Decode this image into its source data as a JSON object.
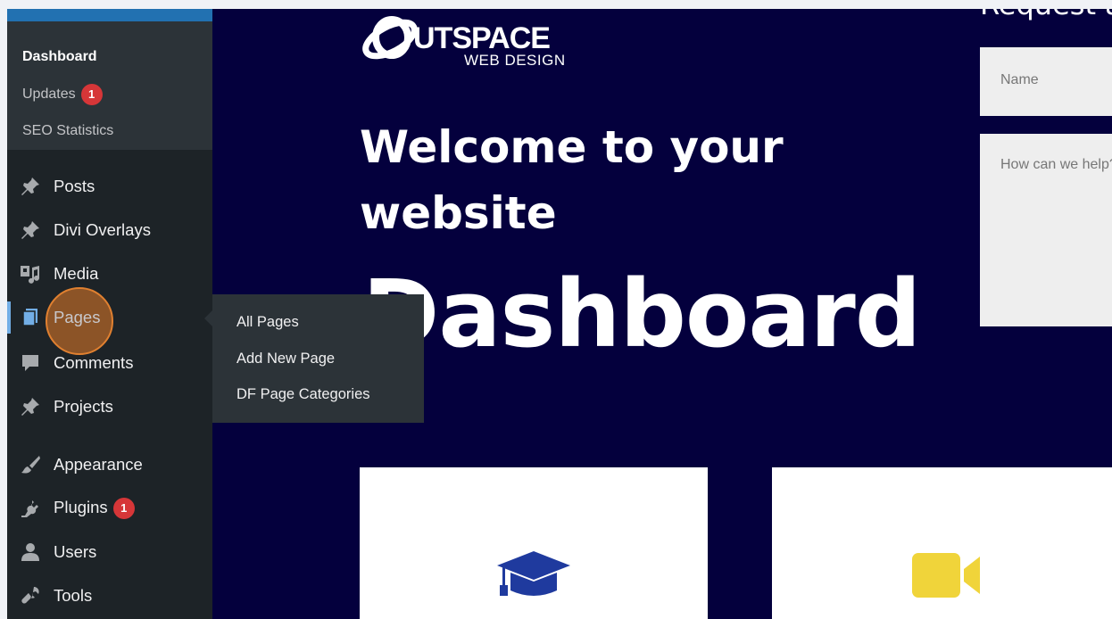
{
  "sidebar": {
    "submenu": [
      {
        "label": "Dashboard",
        "current": true
      },
      {
        "label": "Updates",
        "badge": "1"
      },
      {
        "label": "SEO Statistics"
      }
    ],
    "items": [
      {
        "label": "Posts",
        "icon": "pin-icon"
      },
      {
        "label": "Divi Overlays",
        "icon": "pin-icon"
      },
      {
        "label": "Media",
        "icon": "media-icon"
      },
      {
        "label": "Pages",
        "icon": "pages-icon"
      },
      {
        "label": "Comments",
        "icon": "comment-icon"
      },
      {
        "label": "Projects",
        "icon": "pin-icon"
      },
      {
        "label": "Appearance",
        "icon": "brush-icon"
      },
      {
        "label": "Plugins",
        "icon": "plug-icon",
        "badge": "1"
      },
      {
        "label": "Users",
        "icon": "user-icon"
      },
      {
        "label": "Tools",
        "icon": "wrench-icon"
      }
    ]
  },
  "flyout": {
    "items": [
      "All Pages",
      "Add New Page",
      "DF Page Categories"
    ]
  },
  "main": {
    "logo_main": "UTSPACE",
    "logo_sub": "WEB DESIGN",
    "welcome": "Welcome to your website",
    "title": "Dashboard",
    "request_title": "Request a",
    "name_placeholder": "Name",
    "message_placeholder": "How can we help?"
  },
  "colors": {
    "page_bg": "#04003d",
    "sidebar_bg": "#1d2327",
    "submenu_bg": "#2c3338",
    "badge": "#d63638",
    "accent": "#72aee6",
    "cap_icon": "#1f3a9e",
    "video_icon": "#f0d43a"
  }
}
